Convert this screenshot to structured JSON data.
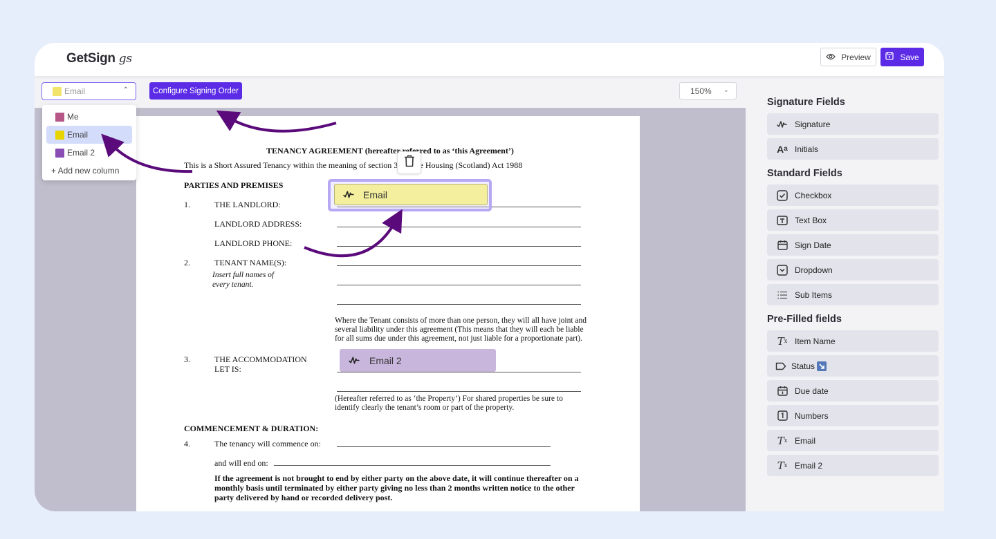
{
  "app": {
    "logo": "GetSign",
    "logo_mark": "gs"
  },
  "header": {
    "preview_label": "Preview",
    "save_label": "Save"
  },
  "toolbar": {
    "column_select": {
      "value": "Email",
      "swatch_color": "#f2e46b"
    },
    "configure_label": "Configure Signing Order",
    "zoom_value": "150%"
  },
  "column_menu": {
    "items": [
      {
        "label": "Me",
        "color": "#b65788",
        "active": false
      },
      {
        "label": "Email",
        "color": "#e8d400",
        "active": true
      },
      {
        "label": "Email 2",
        "color": "#8a4db3",
        "active": false
      }
    ],
    "add_label": "+ Add new column"
  },
  "right_panel": {
    "signature_heading": "Signature Fields",
    "signature_fields": [
      {
        "label": "Signature",
        "icon": "signature-icon"
      },
      {
        "label": "Initials",
        "icon": "initials-icon"
      }
    ],
    "standard_heading": "Standard Fields",
    "standard_fields": [
      {
        "label": "Checkbox",
        "icon": "checkbox-icon"
      },
      {
        "label": "Text Box",
        "icon": "text-box-icon"
      },
      {
        "label": "Sign Date",
        "icon": "calendar-icon"
      },
      {
        "label": "Dropdown",
        "icon": "dropdown-icon"
      },
      {
        "label": "Sub Items",
        "icon": "list-icon"
      }
    ],
    "prefilled_heading": "Pre-Filled fields",
    "prefilled_fields": [
      {
        "label": "Item Name",
        "icon": "clear-format-icon"
      },
      {
        "label": "Status",
        "icon": "tag-icon",
        "badge": "arrow-badge-icon"
      },
      {
        "label": "Due date",
        "icon": "calendar-date-icon"
      },
      {
        "label": "Numbers",
        "icon": "number-icon"
      },
      {
        "label": "Email",
        "icon": "clear-format-icon"
      },
      {
        "label": "Email 2",
        "icon": "clear-format-icon"
      }
    ]
  },
  "document": {
    "title": "TENANCY AGREEMENT (hereafter referred to as ‘this Agreement’)",
    "intro": "This is a Short Assured Tenancy within the meaning of section 32 of the Housing (Scotland) Act 1988",
    "parties_heading": "PARTIES AND PREMISES",
    "item1_num": "1.",
    "item1_label": "THE LANDLORD:",
    "landlord_address": "LANDLORD ADDRESS:",
    "landlord_phone": "LANDLORD PHONE:",
    "item2_num": "2.",
    "item2_label": "TENANT NAME(S):",
    "item2_hint1": "Insert full names of",
    "item2_hint2": "every tenant.",
    "joint_line1": "Where the Tenant consists of more than one person, they will all have joint and",
    "joint_line2": "several liability under this agreement (This means that they will each be liable",
    "joint_line3": "for all sums due under this agreement, not just liable for a proportionate part).",
    "item3_num": "3.",
    "item3_label1": "THE ACCOMMODATION",
    "item3_label2": "LET IS:",
    "property_line1": "(Hereafter referred to as ‘the Property’) For shared properties be sure to",
    "property_line2": "identify clearly the tenant’s room or part of the property.",
    "commencement_heading": "COMMENCEMENT & DURATION:",
    "item4_num": "4.",
    "item4_label": "The tenancy will commence on:",
    "end_label": "and will end on:",
    "continue_line1": "If the agreement is not brought to end by either party on the above date, it will continue thereafter on a",
    "continue_line2": "monthly basis until terminated by either party giving no less than 2 months written notice to the other",
    "continue_line3": "party delivered by hand or recorded delivery post."
  },
  "placed_fields": {
    "email_field": "Email",
    "email2_field": "Email 2"
  },
  "colors": {
    "accent": "#5b2be6",
    "selection_border": "#b7a8f3",
    "email_field_bg": "#f3ef9e",
    "email2_field_bg": "#c9b6dd",
    "annotation_arrow": "#5a0a7a"
  }
}
